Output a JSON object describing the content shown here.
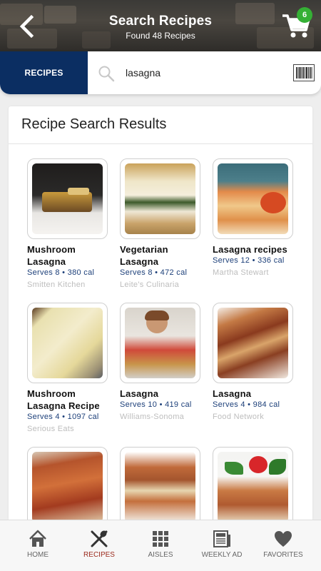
{
  "header": {
    "title": "Search Recipes",
    "subtitle": "Found 48 Recipes",
    "cart_count": "6"
  },
  "search": {
    "tab_label": "RECIPES",
    "query": "lasagna"
  },
  "results": {
    "title": "Recipe Search Results",
    "recipes": [
      {
        "name": "Mushroom Lasagna",
        "serves": "Serves 8 • 380 cal",
        "source": "Smitten Kitchen"
      },
      {
        "name": "Vegetarian Lasagna",
        "serves": "Serves 8 • 472 cal",
        "source": "Leite's Culinaria"
      },
      {
        "name": "Lasagna recipes",
        "serves": "Serves 12 • 336 cal",
        "source": "Martha Stewart"
      },
      {
        "name": "Mushroom Lasagna Recipe",
        "serves": "Serves 4 • 1097 cal",
        "source": "Serious Eats"
      },
      {
        "name": "Lasagna",
        "serves": "Serves 10 • 419 cal",
        "source": "Williams-Sonoma"
      },
      {
        "name": "Lasagna",
        "serves": "Serves 4 • 984 cal",
        "source": "Food Network"
      }
    ]
  },
  "nav": {
    "items": [
      {
        "label": "HOME",
        "icon": "home-icon"
      },
      {
        "label": "RECIPES",
        "icon": "recipes-icon",
        "active": true
      },
      {
        "label": "AISLES",
        "icon": "aisles-icon"
      },
      {
        "label": "WEEKLY AD",
        "icon": "weekly-ad-icon"
      },
      {
        "label": "FAVORITES",
        "icon": "favorites-icon"
      }
    ]
  },
  "colors": {
    "accent_navy": "#0b2e62",
    "badge_green": "#35b035",
    "active_nav": "#9b2a1d",
    "serves_text": "#1c3f79"
  }
}
